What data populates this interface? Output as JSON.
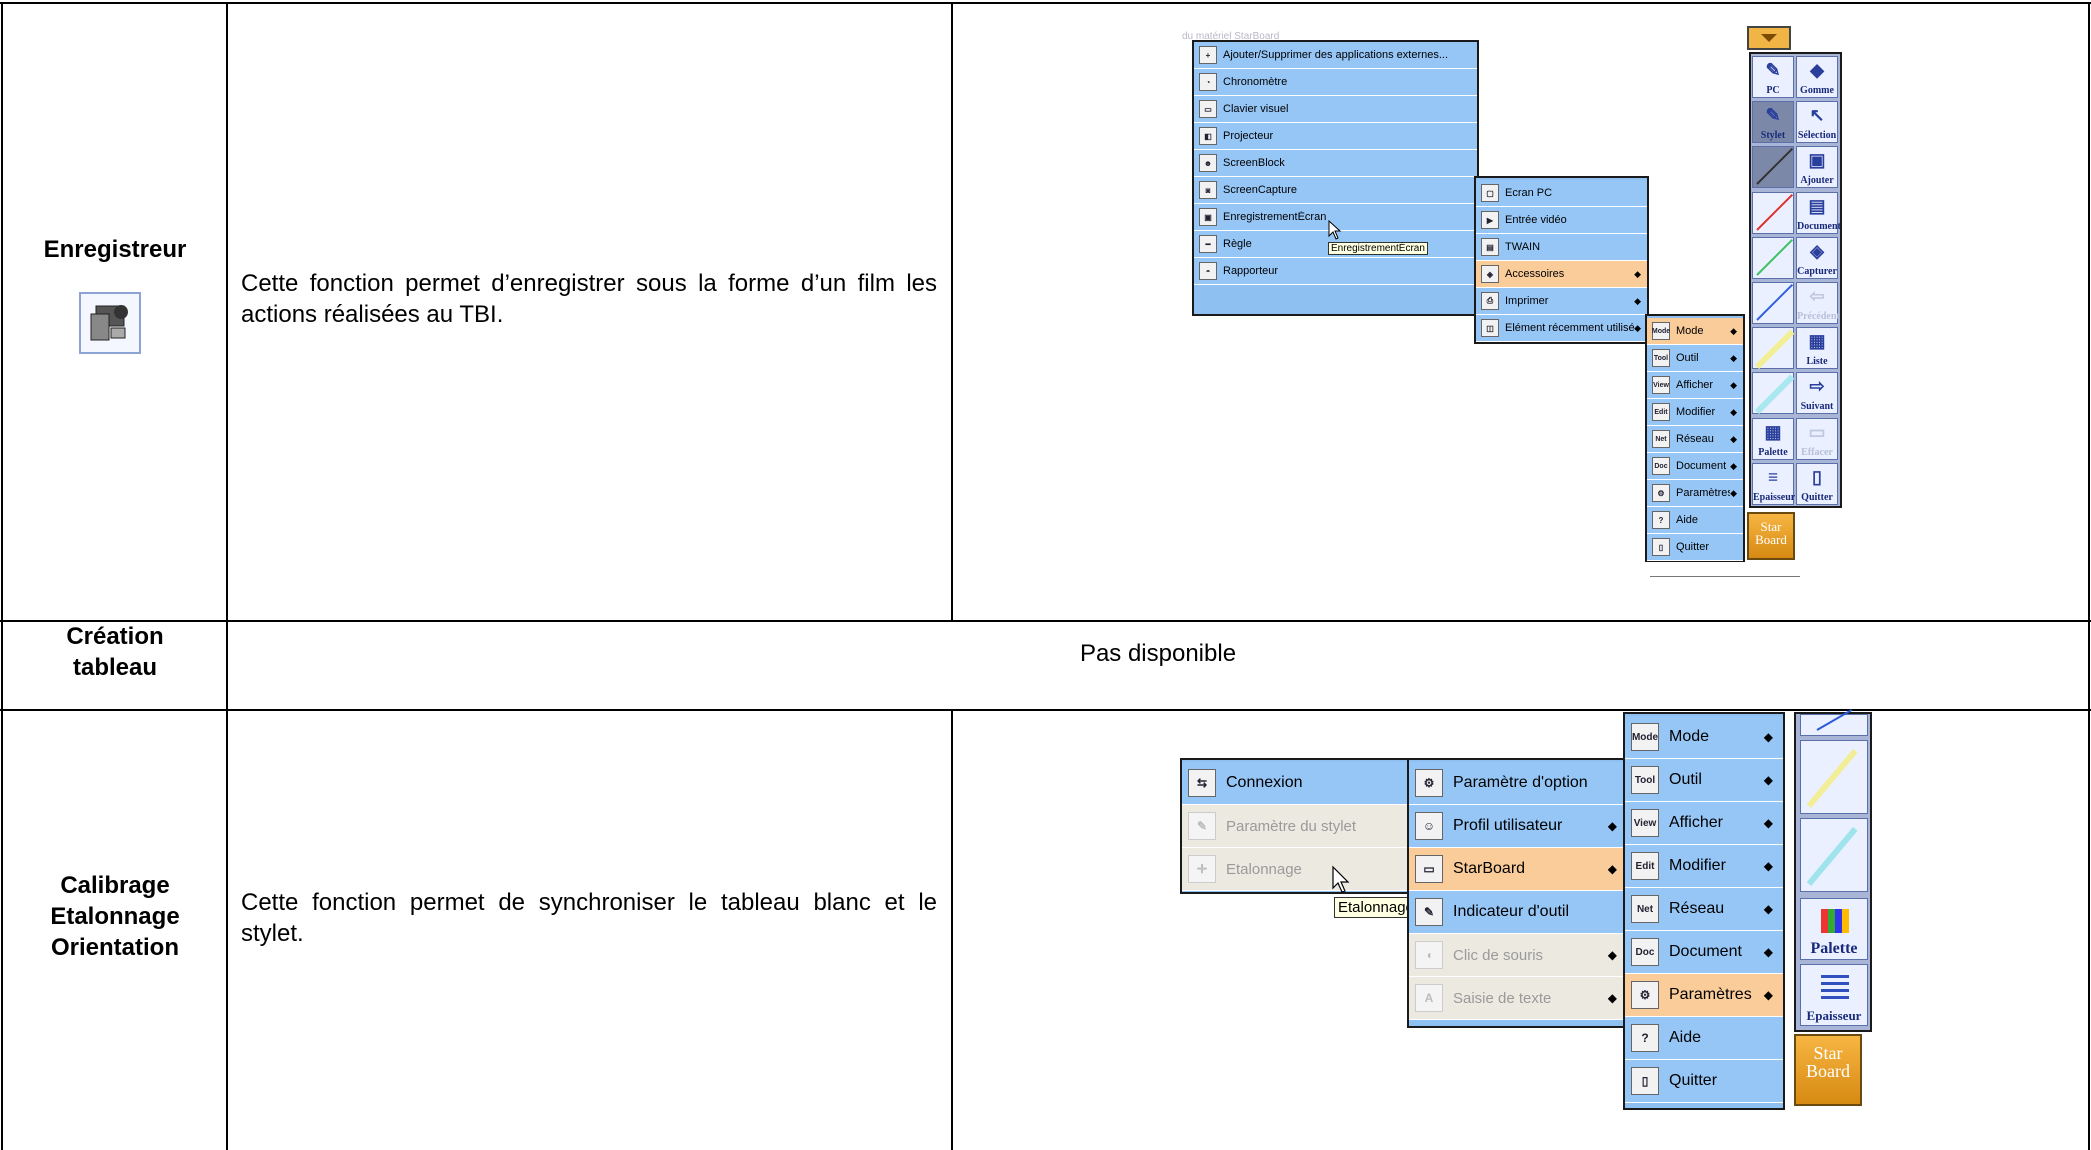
{
  "rows": [
    {
      "feature": "Enregistreur",
      "description": "Cette fonction permet d’enregistrer sous la forme d’un film les actions réalisées au TBI."
    },
    {
      "feature": "Création tableau",
      "description": "Pas disponible"
    },
    {
      "feature": "Calibrage Etalonnage Orientation",
      "description": "Cette fonction permet de synchroniser le tableau blanc et le stylet."
    }
  ],
  "screenshot1": {
    "faded_text": "du matériel StarBoard",
    "accessoires_menu": [
      {
        "icon": "plus-icon",
        "label": "Ajouter/Supprimer des applications externes..."
      },
      {
        "icon": "stopwatch-icon",
        "label": "Chronomètre"
      },
      {
        "icon": "keyboard-icon",
        "label": "Clavier visuel"
      },
      {
        "icon": "projector-icon",
        "label": "Projecteur"
      },
      {
        "icon": "screenblock-icon",
        "label": "ScreenBlock"
      },
      {
        "icon": "camera-icon",
        "label": "ScreenCapture"
      },
      {
        "icon": "recorder-icon",
        "label": "EnregistrementÉcran"
      },
      {
        "icon": "ruler-icon",
        "label": "Règle"
      },
      {
        "icon": "protractor-icon",
        "label": "Rapporteur"
      }
    ],
    "tooltip": "EnregistrementÉcran",
    "affichage_menu": [
      {
        "icon": "pc-screen-icon",
        "label": "Ecran PC",
        "arrow": ""
      },
      {
        "icon": "video-icon",
        "label": "Entrée vidéo",
        "arrow": ""
      },
      {
        "icon": "scanner-icon",
        "label": "TWAIN",
        "arrow": ""
      },
      {
        "icon": "accessories-icon",
        "label": "Accessoires",
        "arrow": "◆"
      },
      {
        "icon": "printer-icon",
        "label": "Imprimer",
        "arrow": "◆"
      },
      {
        "icon": "recent-icon",
        "label": "Elément récemment utilisé",
        "arrow": "◆"
      }
    ],
    "main_menu": [
      {
        "icon_text": "Mode",
        "label": "Mode",
        "arrow": "◆"
      },
      {
        "icon_text": "Tool",
        "label": "Outil",
        "arrow": "◆"
      },
      {
        "icon_text": "View",
        "label": "Afficher",
        "arrow": "◆"
      },
      {
        "icon_text": "Edit",
        "label": "Modifier",
        "arrow": "◆"
      },
      {
        "icon_text": "Net",
        "label": "Réseau",
        "arrow": "◆"
      },
      {
        "icon_text": "Doc",
        "label": "Document",
        "arrow": "◆"
      },
      {
        "icon_text": "",
        "label": "Paramètres",
        "arrow": "◆"
      },
      {
        "icon_text": "",
        "label": "Aide",
        "arrow": ""
      },
      {
        "icon_text": "",
        "label": "Quitter",
        "arrow": ""
      }
    ],
    "toolbar_left": [
      "PC",
      "Stylet",
      "",
      "",
      "",
      "",
      "",
      "",
      "Palette",
      "Epaisseur"
    ],
    "toolbar_right": [
      "Gomme",
      "Sélection",
      "Ajouter",
      "Document",
      "Capturer",
      "Précédent",
      "Liste",
      "Suivant",
      "Effacer",
      "Quitter"
    ],
    "starboard_logo": "Star Board"
  },
  "screenshot2": {
    "calib_menu": [
      {
        "icon": "connect-icon",
        "label": "Connexion",
        "disabled": false
      },
      {
        "icon": "stylus-settings-icon",
        "label": "Paramètre du stylet",
        "disabled": true
      },
      {
        "icon": "calibration-icon",
        "label": "Etalonnage",
        "disabled": true
      }
    ],
    "tooltip": "Etalonnage",
    "params_menu": [
      {
        "icon": "option-icon",
        "label": "Paramètre d'option",
        "arrow": ""
      },
      {
        "icon": "user-profile-icon",
        "label": "Profil utilisateur",
        "arrow": "◆"
      },
      {
        "icon": "starboard-icon",
        "label": "StarBoard",
        "arrow": "◆"
      },
      {
        "icon": "pen-indicator-icon",
        "label": "Indicateur d'outil",
        "arrow": ""
      },
      {
        "icon": "mouse-icon",
        "label": "Clic de souris",
        "arrow": "◆"
      },
      {
        "icon": "text-input-icon",
        "label": "Saisie de texte",
        "arrow": "◆"
      }
    ],
    "main_menu": [
      {
        "icon_text": "Mode",
        "label": "Mode",
        "arrow": "◆"
      },
      {
        "icon_text": "Tool",
        "label": "Outil",
        "arrow": "◆"
      },
      {
        "icon_text": "View",
        "label": "Afficher",
        "arrow": "◆"
      },
      {
        "icon_text": "Edit",
        "label": "Modifier",
        "arrow": "◆"
      },
      {
        "icon_text": "Net",
        "label": "Réseau",
        "arrow": "◆"
      },
      {
        "icon_text": "Doc",
        "label": "Document",
        "arrow": "◆"
      },
      {
        "icon_text": "",
        "label": "Paramètres",
        "arrow": "◆"
      },
      {
        "icon_text": "",
        "label": "Aide",
        "arrow": ""
      },
      {
        "icon_text": "",
        "label": "Quitter",
        "arrow": ""
      }
    ],
    "toolbar": [
      "Palette",
      "Epaisseur"
    ],
    "starboard_logo": "Star Board"
  },
  "colors": {
    "menu_blue": "#96c6f6",
    "menu_highlight": "#f9cc9a",
    "menu_disabled": "#ece9e0",
    "toolbar": "#a8b5d6",
    "starboard_orange": "#e8a030"
  }
}
